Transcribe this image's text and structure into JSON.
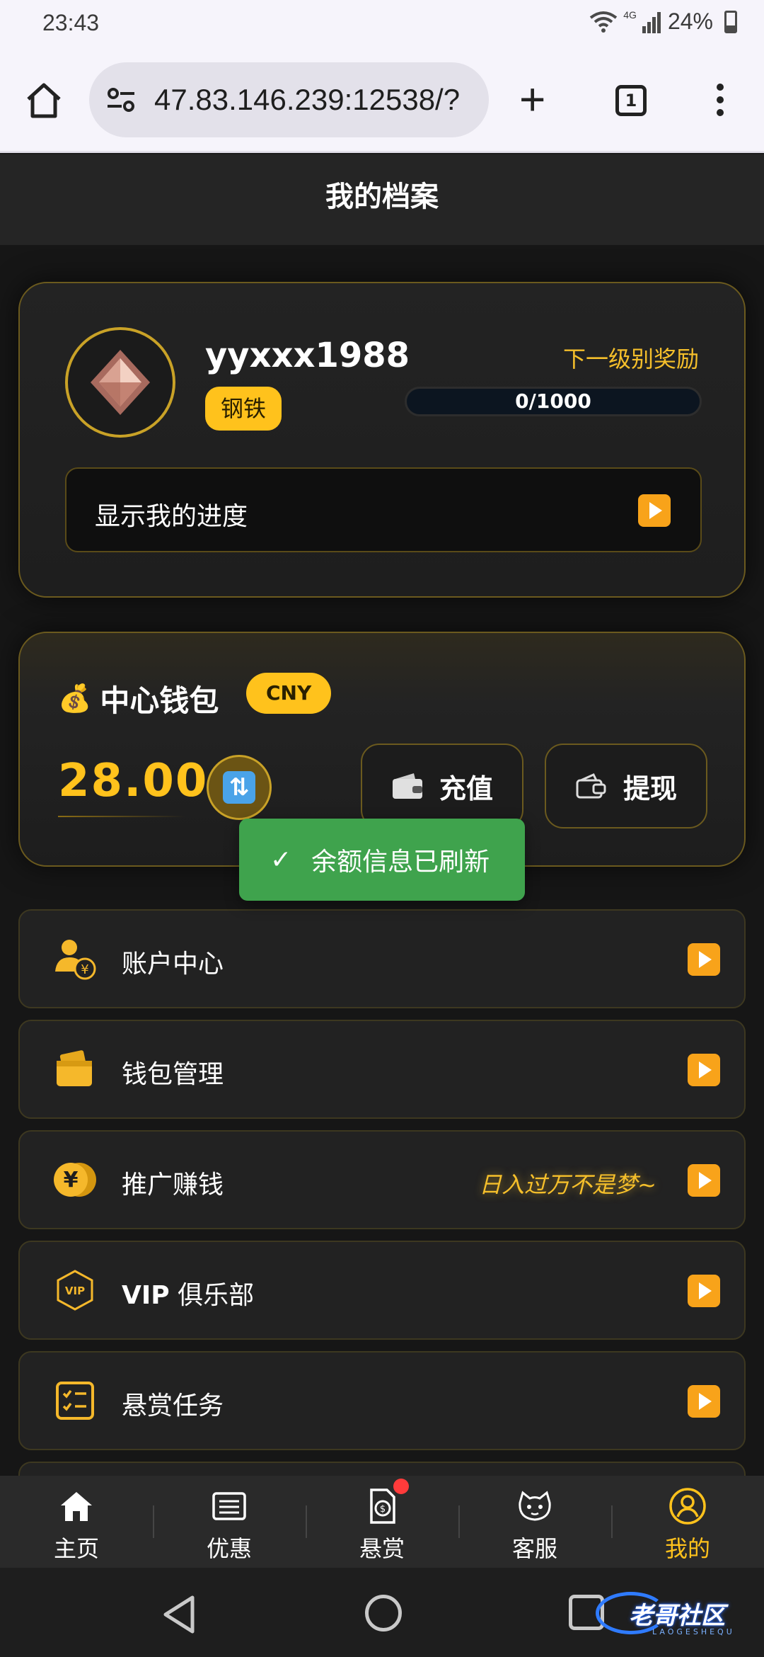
{
  "status_bar": {
    "time": "23:43",
    "network": "4G",
    "battery": "24%"
  },
  "browser": {
    "url": "47.83.146.239:12538/?",
    "tab_count": "1"
  },
  "header": {
    "title": "我的档案"
  },
  "profile": {
    "username": "yyxxx1988",
    "level": "钢铁",
    "next_reward_label": "下一级别奖励",
    "progress_text": "0/1000",
    "progress_fraction": 0,
    "show_progress_label": "显示我的进度"
  },
  "wallet": {
    "icon": "💰",
    "title": "中心钱包",
    "currency": "CNY",
    "balance": "28.00",
    "refresh_icon": "🔃",
    "recharge_label": "充值",
    "withdraw_label": "提现"
  },
  "toast": {
    "message": "余额信息已刷新"
  },
  "menu": {
    "items": [
      {
        "label": "账户中心"
      },
      {
        "label": "钱包管理"
      },
      {
        "label": "推广赚钱",
        "note": "日入过万不是梦~"
      },
      {
        "label_bold": "VIP",
        "label": " 俱乐部"
      },
      {
        "label": "悬赏任务"
      }
    ]
  },
  "bottom_nav": {
    "items": [
      {
        "label": "主页"
      },
      {
        "label": "优惠"
      },
      {
        "label": "悬赏"
      },
      {
        "label": "客服"
      },
      {
        "label": "我的"
      }
    ]
  },
  "watermark": {
    "text": "老哥社区",
    "sub": "LAOGESHEQU"
  },
  "colors": {
    "accent": "#ffc21c",
    "toast": "#3fa34d",
    "badge": "#ff3b3b"
  }
}
